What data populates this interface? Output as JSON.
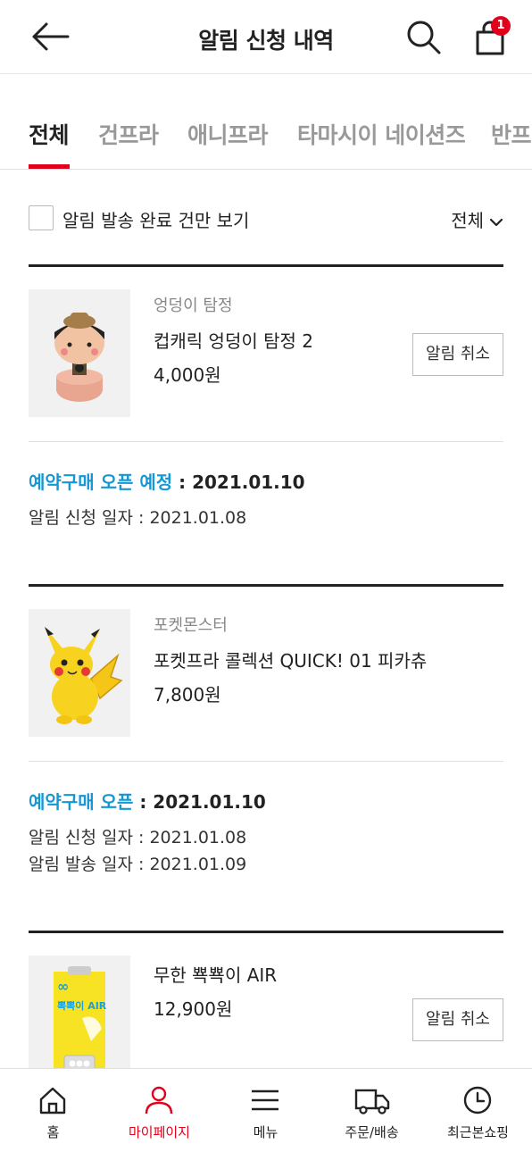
{
  "header": {
    "title": "알림 신청 내역",
    "cart_count": "1",
    "icons": [
      "back-arrow-icon",
      "search-icon",
      "shopping-bag-icon"
    ]
  },
  "tabs": [
    "전체",
    "건프라",
    "애니프라",
    "타마시이 네이션즈",
    "반프"
  ],
  "active_tab": "전체",
  "filter": {
    "label": "알림 발송 완료 건만 보기",
    "sort": "전체"
  },
  "items": [
    {
      "brand": "엉덩이 탐정",
      "name": "컵캐릭 엉덩이 탐정 2",
      "price": "4,000원",
      "cancel_label": "알림 취소",
      "open_label": "예약구매 오픈 예정",
      "open_date": " : 2021.01.10",
      "apply_date": "알림 신청 일자 : 2021.01.08"
    },
    {
      "brand": "포켓몬스터",
      "name": "포켓프라 콜렉션 QUICK! 01 피카츄",
      "price": "7,800원",
      "open_label": "예약구매 오픈",
      "open_date": " : 2021.01.10",
      "apply_date": "알림 신청 일자 : 2021.01.08",
      "sent_date": "알림 발송 일자 : 2021.01.09"
    },
    {
      "name": "무한 뾱뾱이 AIR",
      "price": "12,900원",
      "cancel_label": "알림 취소",
      "thumb_text": "뽁뽁이 AIR"
    }
  ],
  "nav": [
    {
      "label": "홈",
      "icon": "home-icon"
    },
    {
      "label": "마이페이지",
      "icon": "user-icon"
    },
    {
      "label": "메뉴",
      "icon": "menu-icon"
    },
    {
      "label": "주문/배송",
      "icon": "truck-icon"
    },
    {
      "label": "최근본쇼핑",
      "icon": "clock-icon"
    }
  ],
  "active_nav": "마이페이지",
  "colors": {
    "accent": "#e2001a",
    "highlight": "#1597d4"
  }
}
